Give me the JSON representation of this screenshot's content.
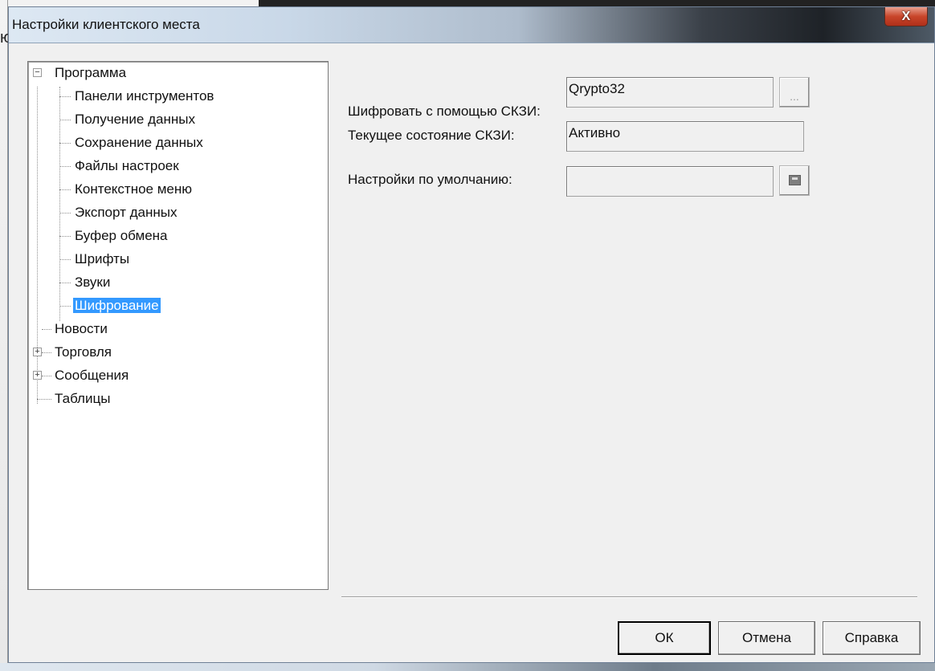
{
  "background": {
    "left_char": "ю"
  },
  "window": {
    "title": "Настройки клиентского места",
    "close_glyph": "X"
  },
  "tree": {
    "root_expanded_glyph": "−",
    "collapsed_glyph": "+",
    "items": [
      {
        "label": "Программа"
      },
      {
        "label": "Панели инструментов"
      },
      {
        "label": "Получение данных"
      },
      {
        "label": "Сохранение данных"
      },
      {
        "label": "Файлы настроек"
      },
      {
        "label": "Контекстное меню"
      },
      {
        "label": "Экспорт данных"
      },
      {
        "label": "Буфер обмена"
      },
      {
        "label": "Шрифты"
      },
      {
        "label": "Звуки"
      },
      {
        "label": "Шифрование"
      },
      {
        "label": "Новости"
      },
      {
        "label": "Торговля"
      },
      {
        "label": "Сообщения"
      },
      {
        "label": "Таблицы"
      }
    ],
    "selected": "Шифрование"
  },
  "settings": {
    "encrypt_label": "Шифровать с помощью СКЗИ:",
    "encrypt_value": "Qrypto32",
    "browse_label": "...",
    "state_label": "Текущее состояние СКЗИ:",
    "state_value": "Активно",
    "defaults_label": "Настройки по умолчанию:",
    "defaults_value": ""
  },
  "buttons": {
    "ok": "ОК",
    "cancel": "Отмена",
    "help": "Справка"
  },
  "colors": {
    "selection": "#3399ff",
    "close_button": "#c8452a"
  }
}
